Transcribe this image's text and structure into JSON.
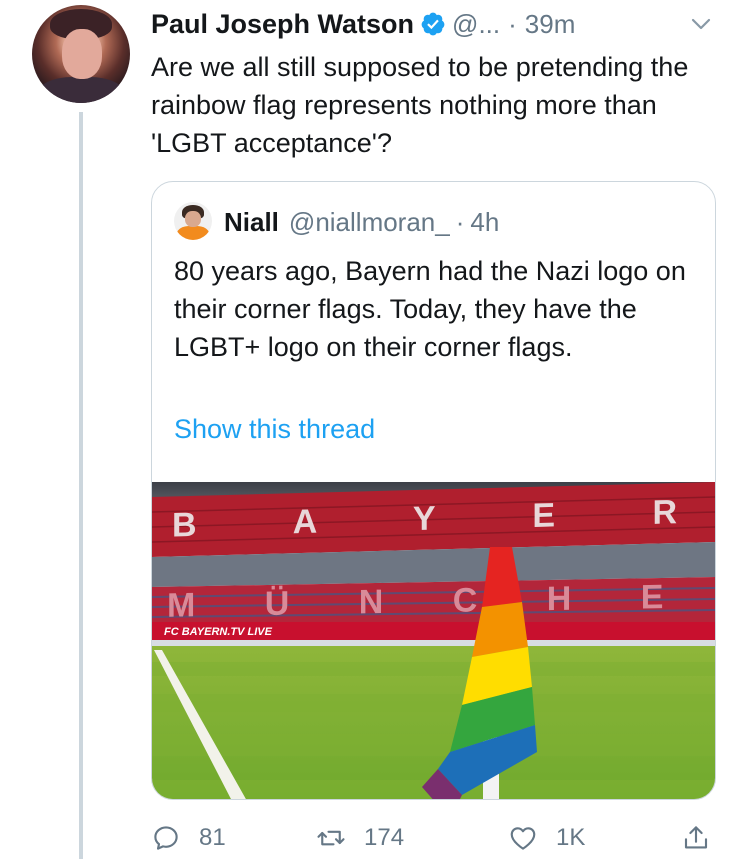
{
  "tweet": {
    "author_name": "Paul Joseph Watson",
    "handle": "@...",
    "separator": "·",
    "time": "39m",
    "text": "Are we all still supposed to be pretending the rainbow flag represents nothing more than 'LGBT acceptance'?",
    "icons": {
      "verified": "verified-badge-icon",
      "menu": "chevron-down-icon"
    }
  },
  "quote": {
    "author_name": "Niall",
    "handle": "@niallmoran_",
    "separator": "·",
    "time": "4h",
    "text": "80 years ago, Bayern had the Nazi logo on their corner flags. Today, they have the LGBT+ logo on their corner flags.",
    "show_thread": "Show this thread",
    "media": {
      "stand_letters_upper": "BAYERN",
      "stand_letters_lower": "MÜNCHEN",
      "board_text": "FC BAYERN.TV LIVE",
      "flag_colors": [
        "#e52421",
        "#f39200",
        "#ffdd00",
        "#34a63e",
        "#1d6fb8",
        "#7a2f6e"
      ]
    }
  },
  "actions": {
    "reply_count": "81",
    "retweet_count": "174",
    "like_count": "1K",
    "icons": [
      "reply-icon",
      "retweet-icon",
      "like-icon",
      "share-icon"
    ]
  },
  "colors": {
    "accent": "#1da1f2",
    "text": "#14171a",
    "secondary": "#657786",
    "border": "#ccd6dd"
  }
}
